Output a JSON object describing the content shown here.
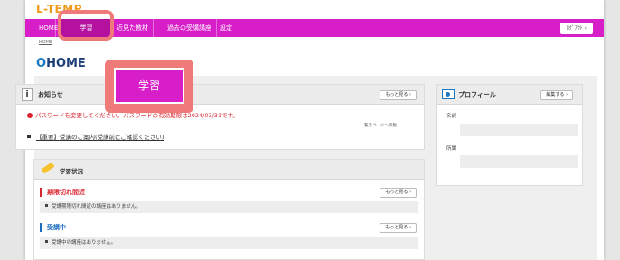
{
  "app": {
    "logo": "L-TEMP"
  },
  "nav": {
    "home": "HOME",
    "study": "学習",
    "edu_materials": "近見た教材",
    "past_courses": "過去の受講講座",
    "settings": "設定",
    "logout": "ﾛｸﾞｱｳﾄ ›"
  },
  "breadcrumb": "HOME",
  "page_title": {
    "prefix": "O",
    "text": "HOME"
  },
  "info": {
    "title": "お知らせ",
    "more": "もっと見る ›",
    "warning": "パスワードを変更してください。パスワードの有効期限は2024/03/31です。",
    "list_link": "一覧をページへ移動",
    "notice": "【重要】受講のご案内(受講前にご確認ください)"
  },
  "study": {
    "title": "学習状況",
    "deadline_title": "期限切れ間近",
    "deadline_more": "もっと見る ›",
    "deadline_empty": "受講期限切れ間近の講座はありません。",
    "active_title": "受講中",
    "active_more": "もっと見る ›",
    "active_empty": "受講中の講座はありません。"
  },
  "profile": {
    "title": "プロフィール",
    "edit": "編集する ›",
    "name_label": "名前",
    "affiliation_label": "所属"
  },
  "callout": {
    "label": "学習"
  },
  "colors": {
    "accent": "#d81ec8",
    "warning": "#d9232d",
    "link_blue": "#1a6cc0",
    "callout": "#ef7a7a"
  }
}
